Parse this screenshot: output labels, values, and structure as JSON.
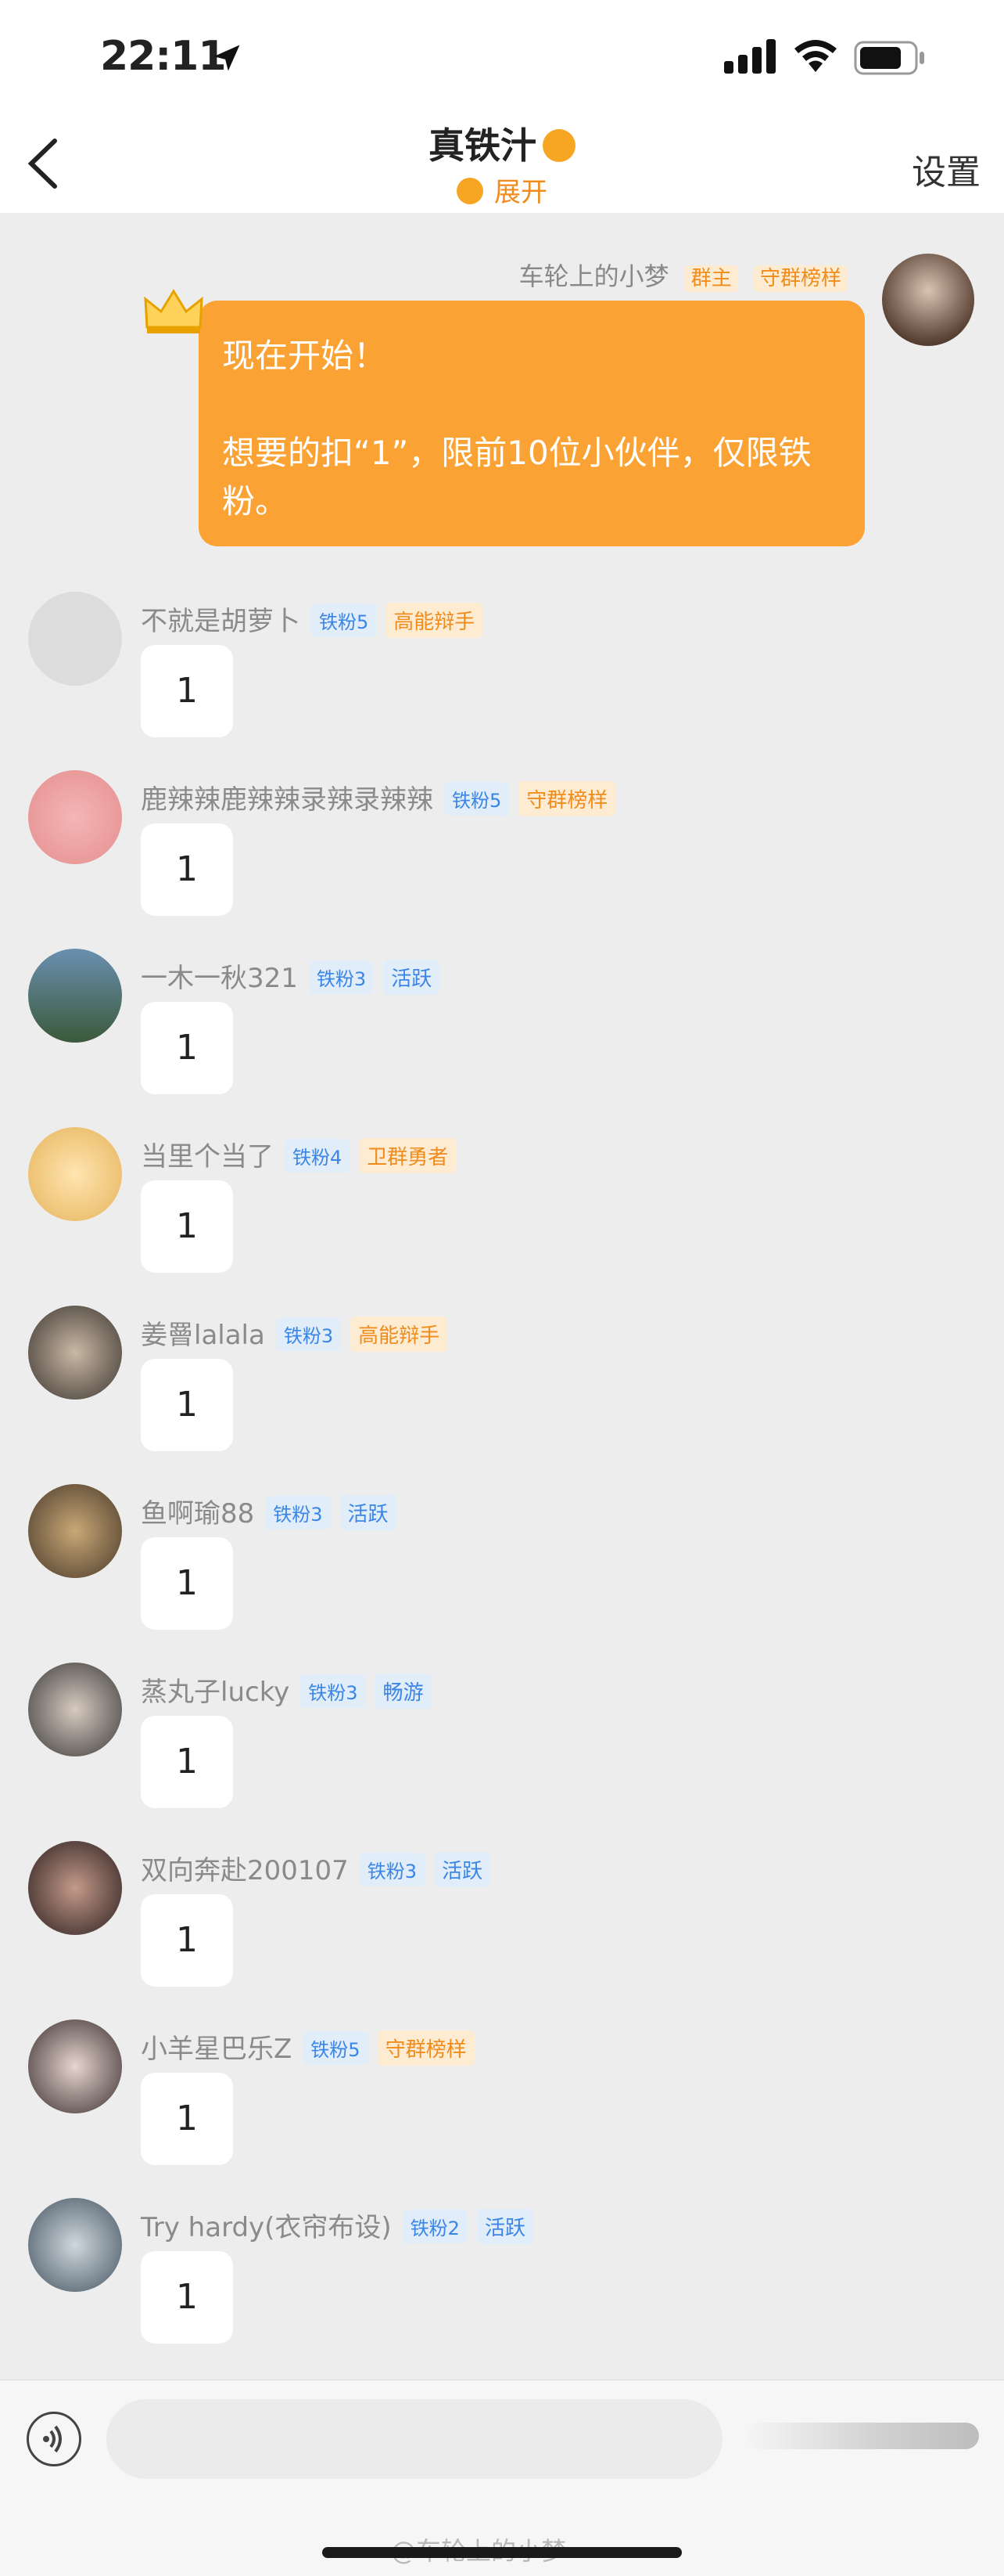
{
  "status_bar": {
    "time": "22:11"
  },
  "nav": {
    "title": "真铁汁",
    "expand": "展开",
    "settings": "设置"
  },
  "host_message": {
    "name": "车轮上的小梦",
    "tags": [
      "群主",
      "守群榜样"
    ],
    "lines": [
      "现在开始！",
      "",
      "想要的扣“1”，限前10位小伙伴，仅限铁粉。"
    ]
  },
  "messages": [
    {
      "name": "不就是胡萝卜",
      "fan": "铁粉5",
      "badge": "高能辩手",
      "badge_color": "orange",
      "text": "1"
    },
    {
      "name": "鹿辣辣鹿辣辣录辣录辣辣",
      "fan": "铁粉5",
      "badge": "守群榜样",
      "badge_color": "orange",
      "text": "1"
    },
    {
      "name": "一木一秋321",
      "fan": "铁粉3",
      "badge": "活跃",
      "badge_color": "blue",
      "text": "1"
    },
    {
      "name": "当里个当了",
      "fan": "铁粉4",
      "badge": "卫群勇者",
      "badge_color": "orange",
      "text": "1"
    },
    {
      "name": "姜罾lalala",
      "fan": "铁粉3",
      "badge": "高能辩手",
      "badge_color": "orange",
      "text": "1"
    },
    {
      "name": "鱼啊瑜88",
      "fan": "铁粉3",
      "badge": "活跃",
      "badge_color": "blue",
      "text": "1"
    },
    {
      "name": "蒸丸子lucky",
      "fan": "铁粉3",
      "badge": "畅游",
      "badge_color": "blue",
      "text": "1"
    },
    {
      "name": "双向奔赴200107",
      "fan": "铁粉3",
      "badge": "活跃",
      "badge_color": "blue",
      "text": "1"
    },
    {
      "name": "小羊星巴乐Z",
      "fan": "铁粉5",
      "badge": "守群榜样",
      "badge_color": "orange",
      "text": "1"
    },
    {
      "name": "Try hardy(衣帘布设)",
      "fan": "铁粉2",
      "badge": "活跃",
      "badge_color": "blue",
      "text": "1"
    }
  ],
  "input": {
    "placeholder": ""
  },
  "watermark": "@车轮上的小梦"
}
